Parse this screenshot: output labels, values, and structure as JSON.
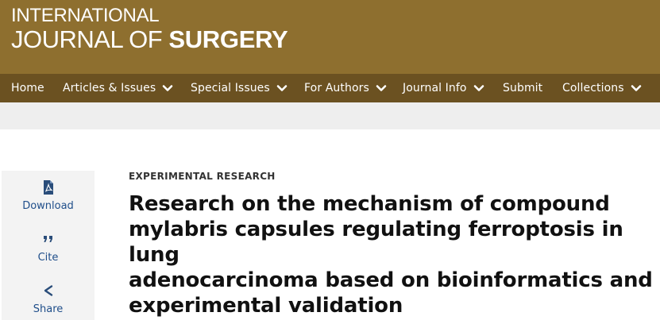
{
  "header": {
    "logo_line1": "INTERNATIONAL",
    "logo_line2_light": "JOURNAL OF ",
    "logo_line2_bold": "SURGERY"
  },
  "nav": {
    "items": [
      {
        "label": "Home",
        "dropdown": false
      },
      {
        "label": "Articles & Issues",
        "dropdown": true
      },
      {
        "label": "Special Issues",
        "dropdown": true
      },
      {
        "label": "For Authors",
        "dropdown": true
      },
      {
        "label": "Journal Info",
        "dropdown": true
      },
      {
        "label": "Submit",
        "dropdown": false
      },
      {
        "label": "Collections",
        "dropdown": true
      }
    ]
  },
  "sidebar": {
    "download_label": "Download",
    "cite_label": "Cite",
    "share_label": "Share"
  },
  "article": {
    "category": "EXPERIMENTAL RESEARCH",
    "title_lines": [
      "Research on the mechanism of compound",
      "mylabris capsules regulating ferroptosis in lung",
      "adenocarcinoma based on bioinformatics and",
      "experimental validation"
    ]
  },
  "colors": {
    "header_bg": "#8e6f2f",
    "nav_bg": "#6b5121",
    "link_blue": "#1f4e8a"
  },
  "icons": {
    "download": "pdf-download-icon",
    "cite": "quote-icon",
    "share": "share-icon",
    "dropdown": "chevron-down-icon"
  }
}
